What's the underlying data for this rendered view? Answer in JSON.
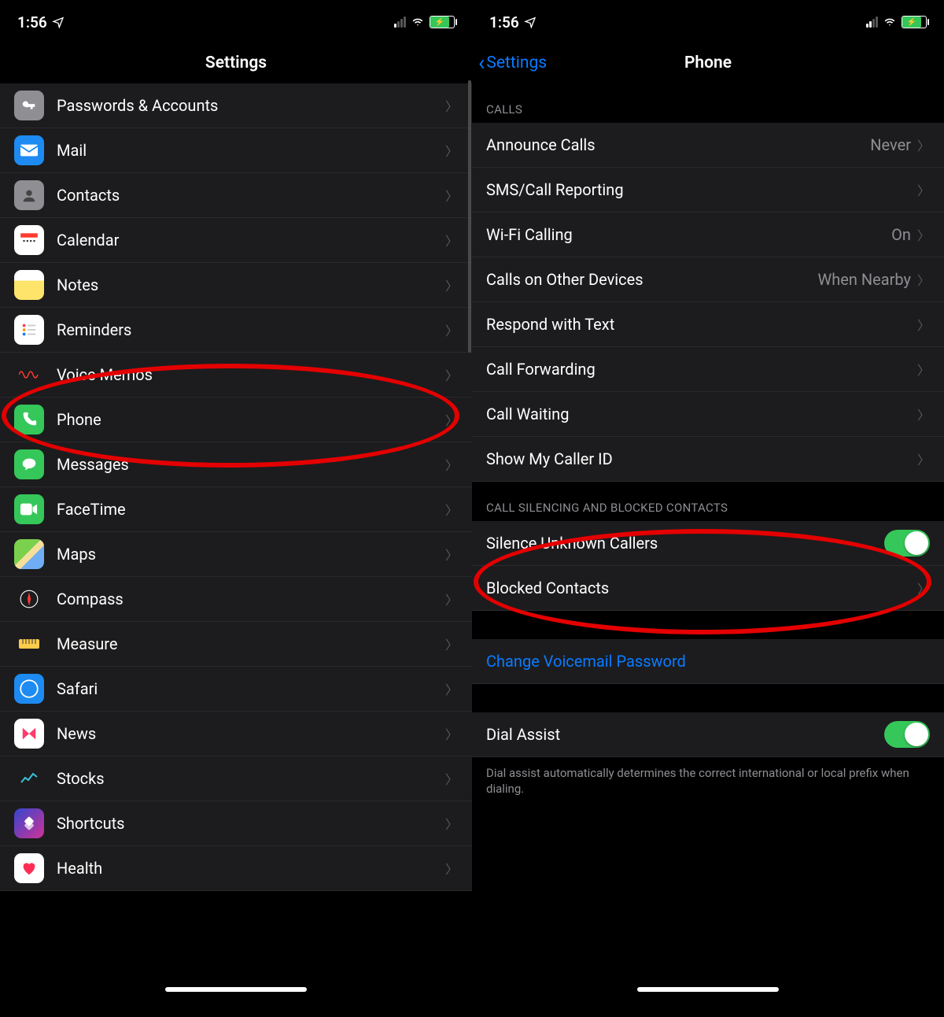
{
  "status": {
    "time": "1:56"
  },
  "screenA": {
    "title": "Settings",
    "items": [
      {
        "label": "Passwords & Accounts",
        "icon": "key",
        "iconBg": "#8e8e93"
      },
      {
        "label": "Mail",
        "icon": "mail",
        "iconBg": "#1d8bf1"
      },
      {
        "label": "Contacts",
        "icon": "contacts",
        "iconBg": "#8e8e93"
      },
      {
        "label": "Calendar",
        "icon": "calendar",
        "iconBg": "#ffffff"
      },
      {
        "label": "Notes",
        "icon": "notes",
        "iconBg": "#ffe46b"
      },
      {
        "label": "Reminders",
        "icon": "reminders",
        "iconBg": "#ffffff"
      },
      {
        "label": "Voice Memos",
        "icon": "voicememos",
        "iconBg": "#1c1c1e"
      },
      {
        "label": "Phone",
        "icon": "phone",
        "iconBg": "#35c759"
      },
      {
        "label": "Messages",
        "icon": "messages",
        "iconBg": "#35c759"
      },
      {
        "label": "FaceTime",
        "icon": "facetime",
        "iconBg": "#35c759"
      },
      {
        "label": "Maps",
        "icon": "maps",
        "iconBg": "#7bd14d"
      },
      {
        "label": "Compass",
        "icon": "compass",
        "iconBg": "#1c1c1e"
      },
      {
        "label": "Measure",
        "icon": "measure",
        "iconBg": "#1c1c1e"
      },
      {
        "label": "Safari",
        "icon": "safari",
        "iconBg": "#1d8bf1"
      },
      {
        "label": "News",
        "icon": "news",
        "iconBg": "#ffffff"
      },
      {
        "label": "Stocks",
        "icon": "stocks",
        "iconBg": "#1c1c1e"
      },
      {
        "label": "Shortcuts",
        "icon": "shortcuts",
        "iconBg": "#3a3457"
      },
      {
        "label": "Health",
        "icon": "health",
        "iconBg": "#ffffff"
      }
    ]
  },
  "screenB": {
    "back": "Settings",
    "title": "Phone",
    "sections": {
      "calls": {
        "header": "CALLS",
        "rows": [
          {
            "label": "Announce Calls",
            "value": "Never"
          },
          {
            "label": "SMS/Call Reporting",
            "value": ""
          },
          {
            "label": "Wi-Fi Calling",
            "value": "On"
          },
          {
            "label": "Calls on Other Devices",
            "value": "When Nearby"
          },
          {
            "label": "Respond with Text",
            "value": ""
          },
          {
            "label": "Call Forwarding",
            "value": ""
          },
          {
            "label": "Call Waiting",
            "value": ""
          },
          {
            "label": "Show My Caller ID",
            "value": ""
          }
        ]
      },
      "silencing": {
        "header": "CALL SILENCING AND BLOCKED CONTACTS",
        "rows": [
          {
            "label": "Silence Unknown Callers",
            "toggle": true
          },
          {
            "label": "Blocked Contacts",
            "value": ""
          }
        ]
      },
      "voicemail": {
        "rows": [
          {
            "label": "Change Voicemail Password",
            "link": true
          }
        ]
      },
      "dial": {
        "rows": [
          {
            "label": "Dial Assist",
            "toggle": true
          }
        ],
        "footer": "Dial assist automatically determines the correct international or local prefix when dialing."
      }
    }
  },
  "icons": {
    "navarrow": "➤"
  }
}
